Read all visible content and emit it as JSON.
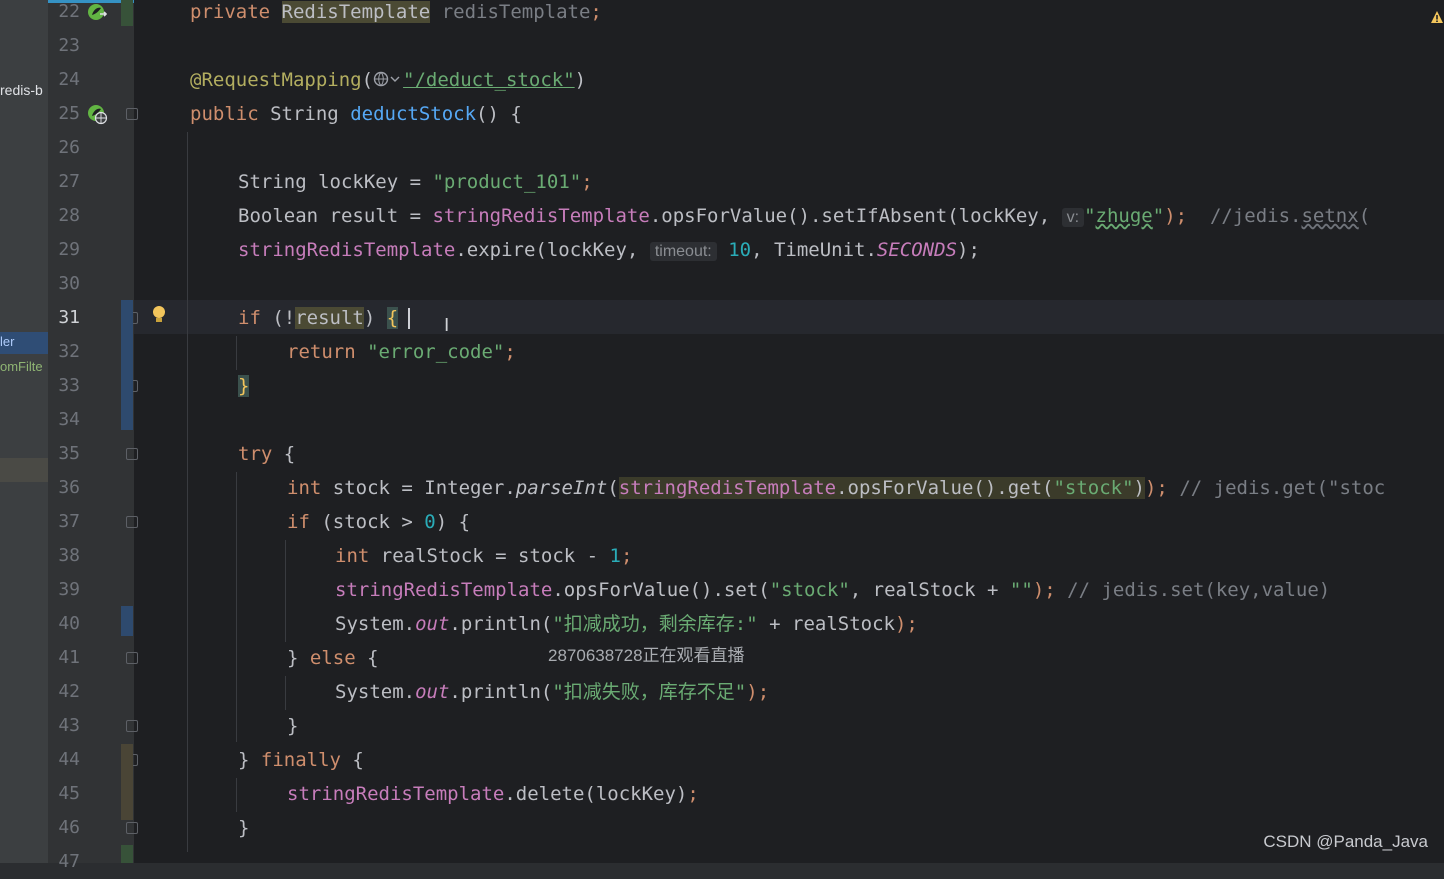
{
  "panel": {
    "project_label": "redis-b",
    "item_controller": "ler",
    "item_filter": "omFilte"
  },
  "editor": {
    "line_numbers": [
      "22",
      "23",
      "24",
      "25",
      "26",
      "27",
      "28",
      "29",
      "30",
      "31",
      "32",
      "33",
      "34",
      "35",
      "36",
      "37",
      "38",
      "39",
      "40",
      "41",
      "42",
      "43",
      "44",
      "45",
      "46",
      "47"
    ],
    "current_line": "31",
    "code": {
      "l22": {
        "kw": "private",
        "type": "RedisTemplate",
        "field": "redisTemplate",
        "end": ";"
      },
      "l24": {
        "ann": "@RequestMapping",
        "open": "(",
        "url": "\"/deduct_stock\"",
        "close": ")"
      },
      "l25": {
        "kw": "public",
        "type": "String",
        "method": "deductStock",
        "rest": "() {"
      },
      "l27": {
        "type": "String",
        "var": " lockKey = ",
        "str": "\"product_101\"",
        "end": ";"
      },
      "l28": {
        "type": "Boolean",
        "var": " result = ",
        "field": "stringRedisTemplate",
        "call": ".opsForValue().setIfAbsent(lockKey, ",
        "hint": "v:",
        "str_q1": "\"",
        "str_word": "zhuge",
        "str_q2": "\"",
        "end": ");",
        "comment_a": "//jedis.",
        "comment_b": "setnx",
        "comment_c": "("
      },
      "l29": {
        "field": "stringRedisTemplate",
        "call": ".expire(lockKey, ",
        "hint": "timeout:",
        "num": "10",
        "mid": ", TimeUnit.",
        "const": "SECONDS",
        "end": ");"
      },
      "l31": {
        "kw": "if",
        "open": " (!",
        "var": "result",
        "close": ") ",
        "brace": "{"
      },
      "l32": {
        "kw": "return",
        "str": "\"error_code\"",
        "end": ";"
      },
      "l33": {
        "brace": "}"
      },
      "l35": {
        "kw": "try",
        "rest": " {"
      },
      "l36": {
        "kw": "int",
        "var": " stock = Integer.",
        "method": "parseInt",
        "open": "(",
        "field": "stringRedisTemplate",
        "call": ".opsForValue().get(",
        "str": "\"stock\"",
        "close": ")",
        "end": ");",
        "comment": " // jedis.get(\"stoc"
      },
      "l37": {
        "kw": "if",
        "open": " (stock > ",
        "num": "0",
        "close": ") {"
      },
      "l38": {
        "kw": "int",
        "var": " realStock = stock - ",
        "num": "1",
        "end": ";"
      },
      "l39": {
        "field": "stringRedisTemplate",
        "call": ".opsForValue().set(",
        "str": "\"stock\"",
        "mid": ", realStock + ",
        "str2": "\"\"",
        "end": ");",
        "comment": " // jedis.set(key,value)"
      },
      "l40": {
        "sys": "System.",
        "out": "out",
        "call": ".println(",
        "str": "\"扣减成功，剩余库存:\"",
        "mid": " + realStock",
        "end": ");"
      },
      "l41": {
        "open": "} ",
        "kw": "else",
        "close": " {"
      },
      "l42": {
        "sys": "System.",
        "out": "out",
        "call": ".println(",
        "str": "\"扣减失败，库存不足\"",
        "end": ");"
      },
      "l43": {
        "brace": "}"
      },
      "l44": {
        "open": "} ",
        "kw": "finally",
        "close": " {"
      },
      "l45": {
        "field": "stringRedisTemplate",
        "call": ".delete(lockKey)",
        "end": ";"
      },
      "l46": {
        "brace": "}"
      }
    }
  },
  "overlay": {
    "live_viewers": "2870638728正在观看直播",
    "watermark": "CSDN @Panda_Java"
  },
  "icons": {
    "bean": "spring-bean-icon",
    "web": "web-endpoint-icon",
    "bulb": "intention-bulb-icon",
    "warning": "warning-icon"
  },
  "colors": {
    "background": "#1e1f22",
    "keyword": "#cf8e6d",
    "string": "#6aab73",
    "field": "#c77dbb",
    "method": "#56a8f5",
    "number": "#2aacb8",
    "annotation": "#b3ae60"
  }
}
